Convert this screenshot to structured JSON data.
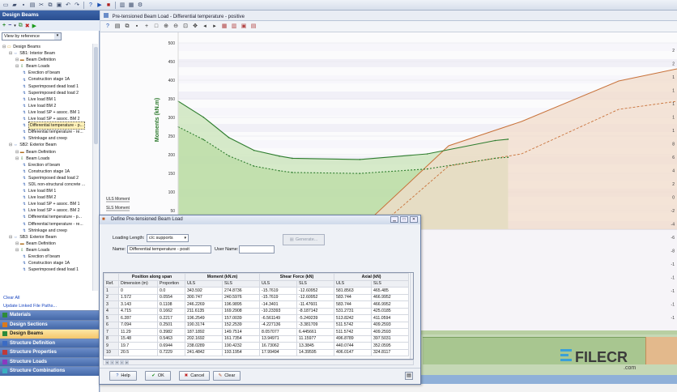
{
  "toolbar_icons": [
    "new-icon",
    "open-icon",
    "save-icon",
    "print-icon",
    "cut-icon",
    "copy-icon",
    "paste-icon",
    "undo-icon",
    "redo-icon",
    "help-icon",
    "run-icon",
    "stop-icon",
    "report-icon",
    "chart-icon",
    "settings-icon"
  ],
  "left_panel": {
    "title": "Design Beams",
    "view_select": "View by reference",
    "tree": [
      {
        "level": 0,
        "icon": "folder",
        "label": "Design Beams"
      },
      {
        "level": 1,
        "icon": "beam",
        "label": "SB1: Interior Beam"
      },
      {
        "level": 2,
        "icon": "def",
        "label": "Beam Definition"
      },
      {
        "level": 2,
        "icon": "loads",
        "label": "Beam Loads"
      },
      {
        "level": 3,
        "icon": "load",
        "label": "Erection of beam"
      },
      {
        "level": 3,
        "icon": "load",
        "label": "Construction stage 1A"
      },
      {
        "level": 3,
        "icon": "load",
        "label": "Superimposed dead load 1"
      },
      {
        "level": 3,
        "icon": "load",
        "label": "Superimposed dead load 2"
      },
      {
        "level": 3,
        "icon": "load",
        "label": "Live load BM 1"
      },
      {
        "level": 3,
        "icon": "load",
        "label": "Live load BM 2"
      },
      {
        "level": 3,
        "icon": "load",
        "label": "Live load SP + assoc. BM 1"
      },
      {
        "level": 3,
        "icon": "load",
        "label": "Live load SP + assoc. BM 2"
      },
      {
        "level": 3,
        "icon": "load",
        "label": "Differential temperature - p...",
        "selected": true
      },
      {
        "level": 3,
        "icon": "load",
        "label": "Differential temperature - re..."
      },
      {
        "level": 3,
        "icon": "load",
        "label": "Shrinkage and creep"
      },
      {
        "level": 1,
        "icon": "beam",
        "label": "SB2: Exterior Beam"
      },
      {
        "level": 2,
        "icon": "def",
        "label": "Beam Definition"
      },
      {
        "level": 2,
        "icon": "loads",
        "label": "Beam Loads"
      },
      {
        "level": 3,
        "icon": "load",
        "label": "Erection of beam"
      },
      {
        "level": 3,
        "icon": "load",
        "label": "Construction stage 1A"
      },
      {
        "level": 3,
        "icon": "load",
        "label": "Superimposed dead load 2"
      },
      {
        "level": 3,
        "icon": "load",
        "label": "SDL non-structural concrete ..."
      },
      {
        "level": 3,
        "icon": "load",
        "label": "Live load BM 1"
      },
      {
        "level": 3,
        "icon": "load",
        "label": "Live load BM 2"
      },
      {
        "level": 3,
        "icon": "load",
        "label": "Live load SP + assoc. BM 1"
      },
      {
        "level": 3,
        "icon": "load",
        "label": "Live load SP + assoc. BM 2"
      },
      {
        "level": 3,
        "icon": "load",
        "label": "Differential temperature - p..."
      },
      {
        "level": 3,
        "icon": "load",
        "label": "Differential temperature - re..."
      },
      {
        "level": 3,
        "icon": "load",
        "label": "Shrinkage and creep"
      },
      {
        "level": 1,
        "icon": "beam",
        "label": "SB3: Exterior Beam"
      },
      {
        "level": 2,
        "icon": "def",
        "label": "Beam Definition"
      },
      {
        "level": 2,
        "icon": "loads",
        "label": "Beam Loads"
      },
      {
        "level": 3,
        "icon": "load",
        "label": "Erection of beam"
      },
      {
        "level": 3,
        "icon": "load",
        "label": "Construction stage 1A"
      },
      {
        "level": 3,
        "icon": "load",
        "label": "Superimposed dead load 1"
      }
    ],
    "links": [
      "Clear All",
      "Update Linked File Paths..."
    ],
    "sections": [
      {
        "label": "Materials",
        "color": "#2e8b3a",
        "open": false
      },
      {
        "label": "Design Sections",
        "color": "#d97a1e",
        "open": false
      },
      {
        "label": "Design Beams",
        "color": "#2e8b3a",
        "open": true
      },
      {
        "label": "Structure Definition",
        "color": "#3a6bc4",
        "open": false
      },
      {
        "label": "Structure Properties",
        "color": "#c03a3a",
        "open": false
      },
      {
        "label": "Structure Loads",
        "color": "#8a3ac0",
        "open": false
      },
      {
        "label": "Structure Combinations",
        "color": "#3ab0c0",
        "open": false
      }
    ]
  },
  "document": {
    "tab_title": "Pre-tensioned Beam Load - Differential temperature - positive",
    "y_axis_label": "Moments (kN.m)",
    "legend": [
      "ULS Moment",
      "SLS Moment"
    ]
  },
  "chart_data": {
    "type": "line",
    "ylabel": "Moments (kN.m)",
    "yticks": [
      500,
      450,
      400,
      350,
      300,
      250,
      200,
      150,
      100,
      50,
      0
    ],
    "ylim": [
      -10,
      500
    ],
    "x": [
      0,
      1.572,
      3.143,
      4.715,
      6.287,
      7.094,
      11.29,
      15.48,
      19.7,
      20.5
    ],
    "series": [
      {
        "name": "ULS Moment",
        "values": [
          343.592,
          300.747,
          246.2269,
          211.6135,
          196.2549,
          190.3174,
          187.1892,
          202.1692,
          238.0289,
          241.4842
        ]
      },
      {
        "name": "SLS Moment",
        "values": [
          274.8736,
          240.5976,
          196.9895,
          169.2908,
          157.0039,
          152.2539,
          149.7514,
          161.7354,
          190.4232,
          193.1954
        ]
      }
    ]
  },
  "right_axis_ticks": [
    "2",
    "2",
    "1",
    "1",
    "1",
    "1",
    "1",
    "8",
    "6",
    "4",
    "2",
    "0",
    "-2",
    "-4",
    "-6",
    "-8",
    "-1",
    "-1",
    "-1",
    "-1",
    "-1"
  ],
  "dialog": {
    "title": "Define Pre-tensioned Beam Load",
    "loading_length_label": "Loading Length:",
    "loading_length_value": "c/c supports",
    "name_label": "Name:",
    "name_value": "Differential temperature - posit",
    "user_name_label": "User Name:",
    "user_name_value": "",
    "generate_label": "Generate...",
    "group_headers": [
      "Position along span",
      "Moment (kN.m)",
      "Shear Force (kN)",
      "Axial (kN)"
    ],
    "columns": [
      "Ref.",
      "Dimension (m)",
      "Proportion",
      "ULS",
      "SLS",
      "ULS",
      "SLS",
      "ULS",
      "SLS"
    ],
    "rows": [
      [
        "1",
        "0",
        "0.0",
        "343.592",
        "274.8736",
        "-15.7619",
        "-12.60952",
        "581.8563",
        "465.485"
      ],
      [
        "2",
        "1.572",
        "0.0554",
        "300.747",
        "240.5976",
        "-15.7619",
        "-12.60952",
        "583.744",
        "466.9952"
      ],
      [
        "3",
        "3.143",
        "0.1108",
        "246.2269",
        "196.9895",
        "-14.3401",
        "-11.47601",
        "583.744",
        "466.9952"
      ],
      [
        "4",
        "4.715",
        "0.1662",
        "211.6135",
        "169.2908",
        "-10.23393",
        "-8.187142",
        "531.2731",
        "425.0185"
      ],
      [
        "5",
        "6.287",
        "0.2217",
        "196.2549",
        "157.0039",
        "-6.561149",
        "-5.249239",
        "513.8242",
        "411.0594"
      ],
      [
        "6",
        "7.094",
        "0.2501",
        "190.3174",
        "152.2539",
        "-4.227136",
        "-3.381709",
        "511.5742",
        "409.2593"
      ],
      [
        "7",
        "11.29",
        "0.3982",
        "187.1892",
        "149.7514",
        "8.057077",
        "6.445661",
        "511.5742",
        "409.2593"
      ],
      [
        "8",
        "15.48",
        "0.5463",
        "202.1692",
        "161.7354",
        "13.94971",
        "11.15977",
        "496.8789",
        "397.5031"
      ],
      [
        "9",
        "19.7",
        "0.6944",
        "238.0289",
        "190.4232",
        "16.73062",
        "13.3845",
        "440.0744",
        "352.0595"
      ],
      [
        "10",
        "20.5",
        "0.7229",
        "241.4842",
        "193.1954",
        "17.99494",
        "14.39595",
        "406.0147",
        "324.8117"
      ]
    ],
    "buttons": {
      "help": "Help",
      "ok": "OK",
      "cancel": "Cancel",
      "clear": "Clear"
    }
  },
  "watermark": {
    "brand": "FILECR",
    "sub": ".com"
  }
}
